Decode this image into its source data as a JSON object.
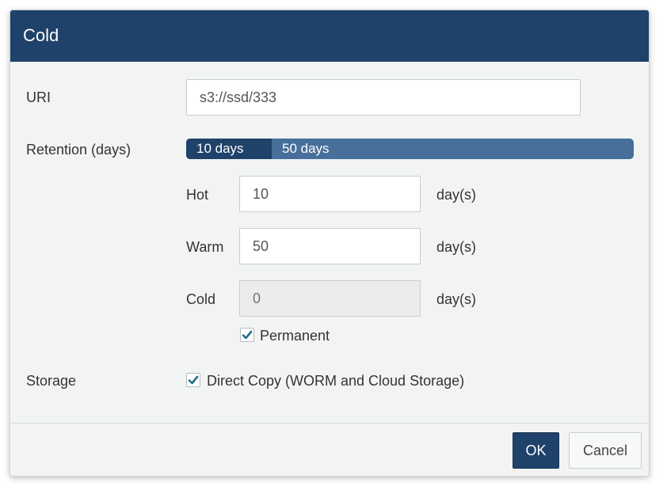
{
  "dialog": {
    "title": "Cold",
    "uri": {
      "label": "URI",
      "value": "s3://ssd/333"
    },
    "retention": {
      "label": "Retention (days)",
      "bar": {
        "hot_label": "10 days",
        "warm_label": "50 days"
      },
      "hot": {
        "label": "Hot",
        "value": "10",
        "unit": "day(s)"
      },
      "warm": {
        "label": "Warm",
        "value": "50",
        "unit": "day(s)"
      },
      "cold": {
        "label": "Cold",
        "value": "0",
        "unit": "day(s)",
        "disabled": true
      },
      "permanent": {
        "label": "Permanent",
        "checked": true
      }
    },
    "storage": {
      "label": "Storage",
      "direct_copy": {
        "label": "Direct Copy (WORM and Cloud Storage)",
        "checked": true
      }
    },
    "buttons": {
      "ok": "OK",
      "cancel": "Cancel"
    }
  },
  "colors": {
    "header": "#1f426a",
    "retention_hot": "#1f426a",
    "retention_warm": "#476f9a",
    "checkmark": "#1f6f8b"
  }
}
